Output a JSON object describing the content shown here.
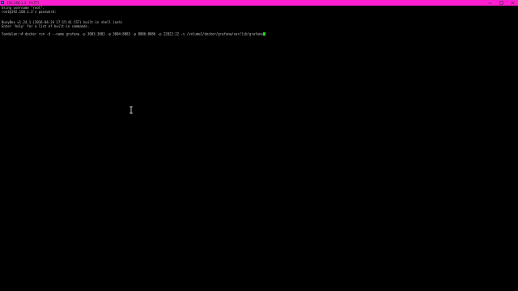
{
  "window": {
    "title": "192.168.1.3 - PuTTY",
    "icon": "putty-icon"
  },
  "controls": {
    "minimize": "minimize-icon",
    "maximize": "maximize-icon",
    "close": "close-icon"
  },
  "terminal": {
    "lines": [
      "Using username \"root\".",
      "root@192.168.1.3's password:",
      "",
      "",
      "BusyBox v1.24.1 (2016-04-24 17:15:41 CST) built-in shell (ash)",
      "Enter 'help' for a list of built-in commands.",
      "",
      "Yandalan:~# docker run -d --name grafana -p 3003:3003 -p 3004:8083 -p 8086:8086 -p 22022:22 -v /volume1/docker/grafana/var/lib/grafana"
    ],
    "cursor_color": "#16e216"
  },
  "colors": {
    "titlebar": "#ff1fd0",
    "background": "#000000",
    "text": "#c8c8c8"
  }
}
